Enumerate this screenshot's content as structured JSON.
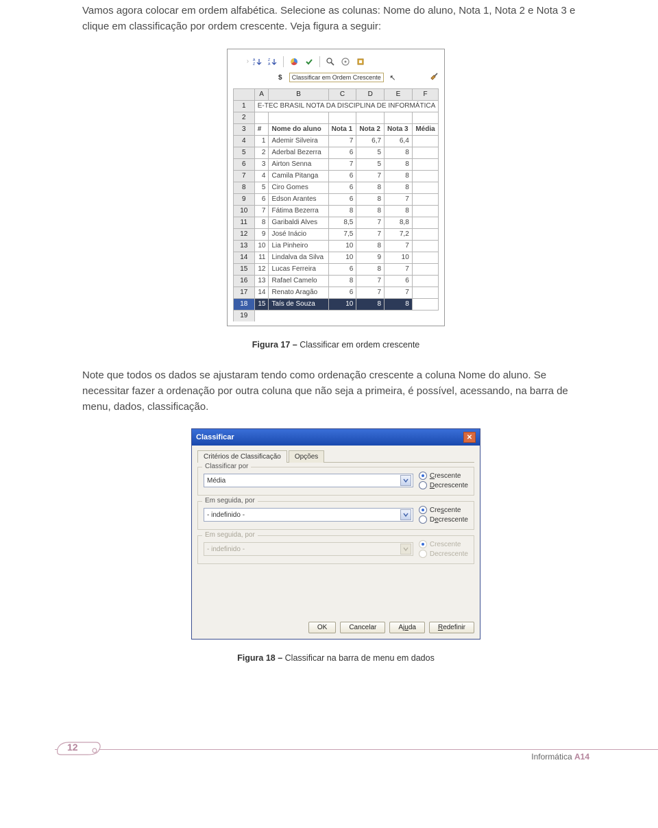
{
  "para1": "Vamos agora colocar em ordem alfabética. Selecione as colunas: Nome do aluno, Nota 1, Nota 2 e Nota 3 e clique em classificação por ordem crescente. Veja figura a seguir:",
  "para2": "Note que todos os dados se ajustaram tendo como ordenação crescente a coluna Nome do aluno. Se necessitar fazer a ordenação por outra coluna que não seja a primeira, é possível, acessando, na barra de menu, dados, classificação.",
  "fig17": {
    "label": "Figura 17 –",
    "title": "Classificar em ordem crescente"
  },
  "fig18": {
    "label": "Figura 18 –",
    "title": "Classificar na barra de menu em dados"
  },
  "toolbar": {
    "tooltip": "Classificar em Ordem Crescente",
    "icons": {
      "sortAsc": "sort-asc-icon",
      "sortDesc": "sort-desc-icon",
      "chart": "chart-icon",
      "sum": "sigma-icon",
      "find": "find-icon",
      "check": "check-icon",
      "wizard": "wizard-icon",
      "paint": "paintbrush-icon",
      "dollar": "$"
    }
  },
  "sheet": {
    "cols": [
      "",
      "A",
      "B",
      "C",
      "D",
      "E",
      "F"
    ],
    "titleRow": {
      "rh": "1",
      "text": "E-TEC BRASIL NOTA DA DISCIPLINA DE INFORMÁTICA"
    },
    "blankRow": {
      "rh": "2"
    },
    "headerRow": {
      "rh": "3",
      "cells": [
        "#",
        "Nome do aluno",
        "Nota 1",
        "Nota 2",
        "Nota 3",
        "Média"
      ]
    },
    "rows": [
      {
        "rh": "4",
        "n": "1",
        "nome": "Ademir Silveira",
        "n1": "7",
        "n2": "6,7",
        "n3": "6,4"
      },
      {
        "rh": "5",
        "n": "2",
        "nome": "Aderbal Bezerra",
        "n1": "6",
        "n2": "5",
        "n3": "8"
      },
      {
        "rh": "6",
        "n": "3",
        "nome": "Airton Senna",
        "n1": "7",
        "n2": "5",
        "n3": "8"
      },
      {
        "rh": "7",
        "n": "4",
        "nome": "Camila Pitanga",
        "n1": "6",
        "n2": "7",
        "n3": "8"
      },
      {
        "rh": "8",
        "n": "5",
        "nome": "Ciro Gomes",
        "n1": "6",
        "n2": "8",
        "n3": "8"
      },
      {
        "rh": "9",
        "n": "6",
        "nome": "Edson Arantes",
        "n1": "6",
        "n2": "8",
        "n3": "7"
      },
      {
        "rh": "10",
        "n": "7",
        "nome": "Fátima Bezerra",
        "n1": "8",
        "n2": "8",
        "n3": "8"
      },
      {
        "rh": "11",
        "n": "8",
        "nome": "Garibaldi Alves",
        "n1": "8,5",
        "n2": "7",
        "n3": "8,8"
      },
      {
        "rh": "12",
        "n": "9",
        "nome": "José Inácio",
        "n1": "7,5",
        "n2": "7",
        "n3": "7,2"
      },
      {
        "rh": "13",
        "n": "10",
        "nome": "Lia Pinheiro",
        "n1": "10",
        "n2": "8",
        "n3": "7"
      },
      {
        "rh": "14",
        "n": "11",
        "nome": "Lindalva da Silva",
        "n1": "10",
        "n2": "9",
        "n3": "10"
      },
      {
        "rh": "15",
        "n": "12",
        "nome": "Lucas Ferreira",
        "n1": "6",
        "n2": "8",
        "n3": "7"
      },
      {
        "rh": "16",
        "n": "13",
        "nome": "Rafael Camelo",
        "n1": "8",
        "n2": "7",
        "n3": "6"
      },
      {
        "rh": "17",
        "n": "14",
        "nome": "Renato Aragão",
        "n1": "6",
        "n2": "7",
        "n3": "7"
      },
      {
        "rh": "18",
        "n": "15",
        "nome": "Taís de Souza",
        "n1": "10",
        "n2": "8",
        "n3": "8"
      }
    ],
    "tailRow": {
      "rh": "19"
    }
  },
  "dialog": {
    "title": "Classificar",
    "tabs": {
      "criteria": "Critérios de Classificação",
      "options": "Opções"
    },
    "group1": {
      "legend": "Classificar por",
      "value": "Média"
    },
    "group2": {
      "legend": "Em seguida, por",
      "value": "- indefinido -"
    },
    "group3": {
      "legend": "Em seguida, por",
      "value": "- indefinido -"
    },
    "radio": {
      "asc": "Crescente",
      "desc": "Decrescente",
      "asc2": "Crescente",
      "desc2": "Decrescente",
      "asc3": "Crescente",
      "desc3": "Decrescente"
    },
    "buttons": {
      "ok": "OK",
      "cancel": "Cancelar",
      "help": "Ajuda",
      "reset": "Redefinir"
    }
  },
  "footer": {
    "pageNumber": "12",
    "subject": "Informática",
    "code": "A14"
  }
}
